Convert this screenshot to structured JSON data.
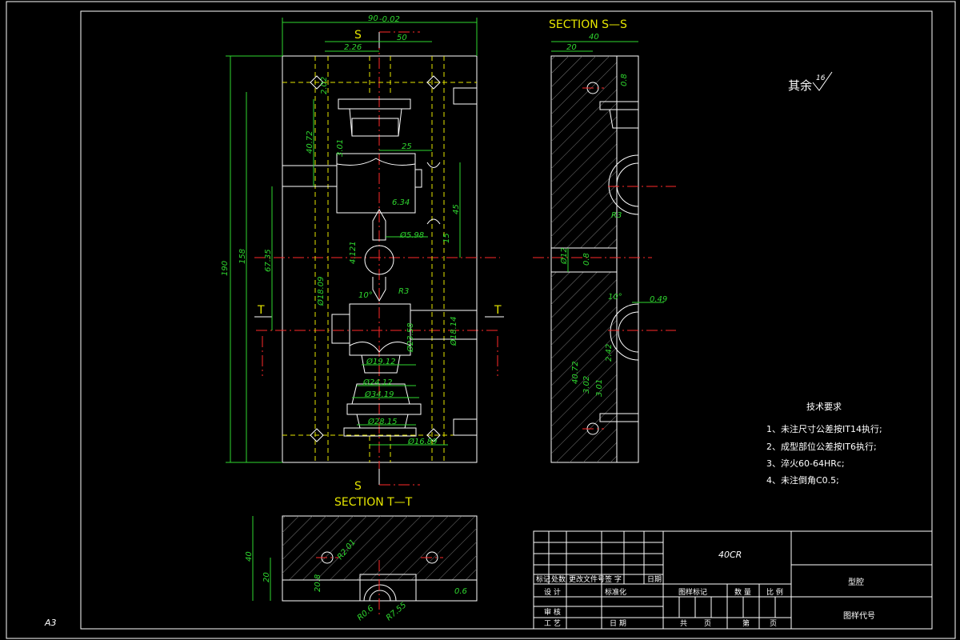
{
  "sheet": {
    "size_label": "A3",
    "roughness_label": "其余",
    "roughness_value": "16"
  },
  "sections": {
    "s_title": "SECTION S—S",
    "t_title": "SECTION T—T",
    "s_marker": "S",
    "t_marker": "T"
  },
  "dimensions": {
    "main_width": "90",
    "main_width_tol": "-0.02",
    "top_50": "50",
    "top_226": "2.26",
    "dim_202": "2.02",
    "dim_4072": "40.72",
    "dim_301": "3.01",
    "dim_25": "25",
    "dim_45": "45",
    "dim_15": "15",
    "dim_634": "6.34",
    "dim_598": "Ø5.98",
    "dim_158": "158",
    "dim_6735": "67.35",
    "dim_190": "190",
    "dim_190_tol": "-0.02",
    "dim_4121": "4.121",
    "dim_r3": "R3",
    "dim_10deg": "10°",
    "dim_18": "Ø18.09",
    "dim_23": "Ø23.58",
    "dim_1814": "Ø18.14",
    "dim_1912": "Ø19.12",
    "dim_2412": "Ø24.12",
    "dim_3419": "Ø34.19",
    "dim_2815": "Ø28.15",
    "dim_1689": "Ø16.89",
    "ss_40": "40",
    "ss_20": "20",
    "ss_08a": "0.8",
    "ss_phi12": "Ø12",
    "ss_08b": "0.8",
    "ss_10deg": "10°",
    "ss_049": "0.49",
    "ss_4072": "40.72",
    "ss_302": "3.02",
    "ss_301": "3.01",
    "ss_242": "2.42",
    "ss_r3": "R3",
    "tt_40": "40",
    "tt_20": "20",
    "tt_r201": "R2.01",
    "tt_208": "20.8",
    "tt_r06": "R0.6",
    "tt_r755": "R7.55",
    "tt_06": "0.6"
  },
  "tech_requirements": {
    "heading": "技术要求",
    "items": [
      "1、未注尺寸公差按IT14执行;",
      "2、成型部位公差按IT6执行;",
      "3、淬火60-64HRc;",
      "4、未注倒角C0.5;"
    ]
  },
  "title_block": {
    "material": "40CR",
    "part_name": "型腔",
    "drawing_no": "图样代号",
    "headers": [
      "标记",
      "处数",
      "更改文件号",
      "签 字",
      "日期"
    ],
    "row_design": [
      "设 计",
      "",
      "标准化"
    ],
    "row_review": [
      "审 核"
    ],
    "row_process": [
      "工 艺",
      "",
      "日 期"
    ],
    "mark_cols": [
      "图样标记",
      "数 量",
      "比 例"
    ],
    "pages": [
      "共",
      "页",
      "第",
      "页"
    ]
  }
}
